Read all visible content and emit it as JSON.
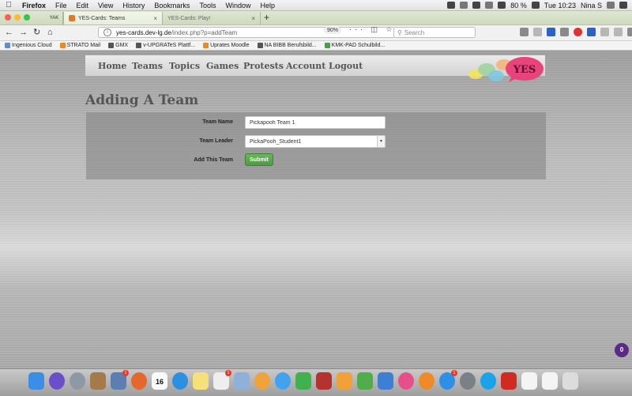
{
  "menubar": {
    "app": "Firefox",
    "items": [
      "File",
      "Edit",
      "View",
      "History",
      "Bookmarks",
      "Tools",
      "Window",
      "Help"
    ],
    "battery": "80 %",
    "clock": "Tue 10:23",
    "user": "Nina S"
  },
  "tabs": {
    "pinned_label": "YAK",
    "items": [
      {
        "label": "YES-Cards: Teams"
      },
      {
        "label": "YES-Cards: Play!"
      }
    ]
  },
  "navbar": {
    "url_host": "yes-cards.dev-lg.de",
    "url_path": "/index.php?p=addTeam",
    "zoom": "90%",
    "search_placeholder": "Search"
  },
  "bookmarks": [
    {
      "label": "Ingenious Cloud",
      "icon": "cloud-icon"
    },
    {
      "label": "STRATO Mail",
      "icon": "mail-icon"
    },
    {
      "label": "GMX",
      "icon": "gmx-icon"
    },
    {
      "label": "v-UPGRATeS Plattf...",
      "icon": "globe-icon"
    },
    {
      "label": "Uprates Moodle",
      "icon": "moodle-icon"
    },
    {
      "label": "NA BIBB Berufsbild...",
      "icon": "bibb-icon"
    },
    {
      "label": "KMK-PAD Schulbild...",
      "icon": "kmk-icon"
    }
  ],
  "site": {
    "nav": [
      "Home",
      "Teams",
      "Topics",
      "Games",
      "Protests",
      "Account",
      "Logout"
    ],
    "logo_text": "YES",
    "heading": "Adding A Team",
    "form": {
      "team_name_label": "Team Name",
      "team_name_value": "Pickapooh Team 1",
      "team_leader_label": "Team Leader",
      "team_leader_value": "PickaPooh_Student1",
      "add_label": "Add This Team",
      "submit_label": "Submit"
    },
    "notification_count": "0"
  },
  "dock": {
    "calendar_day": "16",
    "icons": [
      "finder-icon",
      "siri-icon",
      "launchpad-icon",
      "contacts-icon",
      "preview-icon",
      "firefox-icon",
      "calendar-icon",
      "safari-icon",
      "notes-icon",
      "reminders-icon",
      "preview-photos-icon",
      "photos-icon",
      "messages-icon",
      "facetime-icon",
      "photo-booth-icon",
      "pages-icon",
      "numbers-icon",
      "keynote-icon",
      "itunes-icon",
      "ibooks-icon",
      "app-store-icon",
      "system-preferences-icon",
      "skype-icon",
      "acrobat-icon",
      "document-icon",
      "document-icon",
      "trash-icon"
    ]
  }
}
